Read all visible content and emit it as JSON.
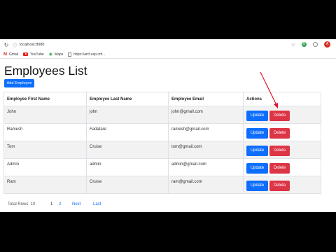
{
  "browser": {
    "url": "localhost:8080",
    "bookmarks": [
      {
        "label": "Gmail",
        "icon": "gmail-icon"
      },
      {
        "label": "YouTube",
        "icon": "youtube-icon"
      },
      {
        "label": "Maps",
        "icon": "maps-icon"
      },
      {
        "label": "https://arcf.esp.crif...",
        "icon": "page-icon"
      }
    ],
    "ext_g_letter": "G",
    "avatar_letter": "A"
  },
  "page": {
    "title": "Employees List",
    "add_button": "Add Employee"
  },
  "table": {
    "headers": [
      "Employee First Name",
      "Employee Last Name",
      "Employee Email",
      "Actions"
    ],
    "rows": [
      [
        "John",
        "john",
        "john@gmail.com"
      ],
      [
        "Ramesh",
        "Fadatare",
        "ramesh@gmail.com"
      ],
      [
        "Tom",
        "Cruise",
        "tom@gmail.com"
      ],
      [
        "Admin",
        "admin",
        "admin@gmail.com"
      ],
      [
        "Ram",
        "Cruise",
        "ram@gmail.com"
      ]
    ],
    "update_label": "Update",
    "delete_label": "Delete"
  },
  "footer": {
    "total_rows": "Total Rows: 10",
    "pages": [
      "1",
      "2"
    ],
    "next": "Next",
    "last": "Last"
  },
  "colors": {
    "primary": "#0d6efd",
    "danger": "#dc3545",
    "annotation_arrow": "#e8132b"
  }
}
